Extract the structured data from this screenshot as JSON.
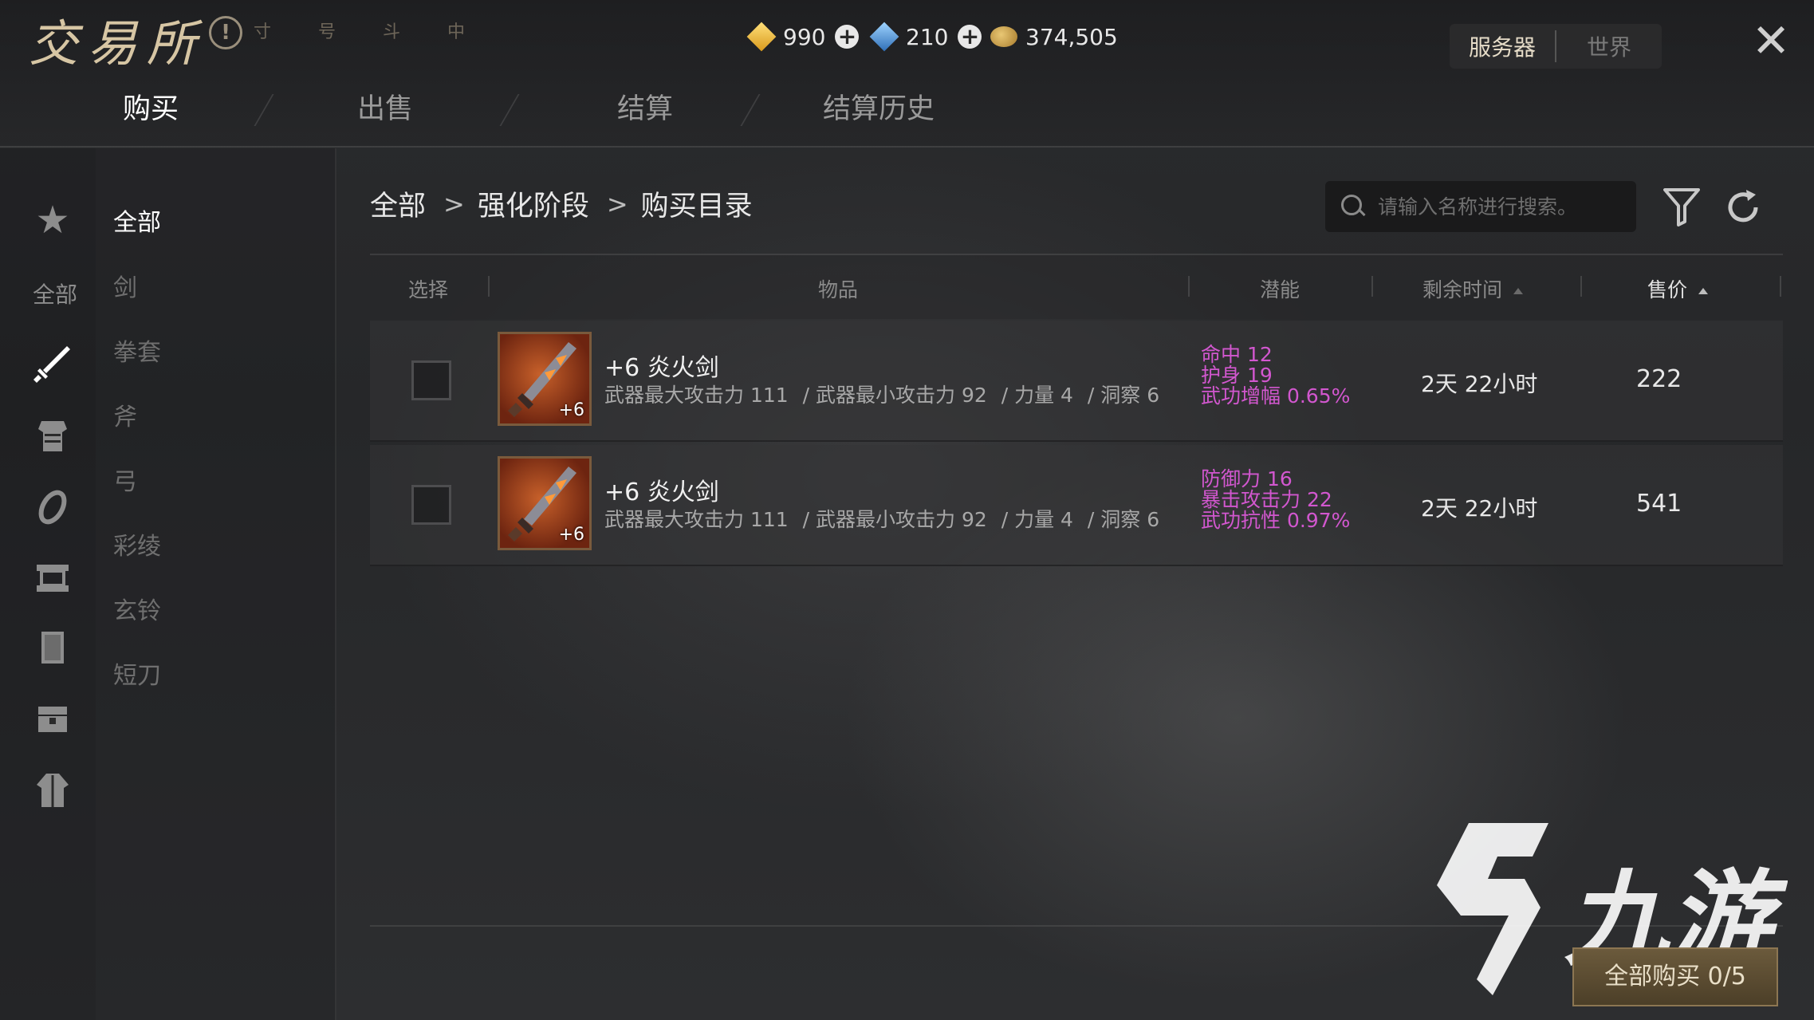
{
  "header": {
    "title": "交易所",
    "faint_marks": "寸 号 斗 中"
  },
  "currencies": [
    {
      "name": "gold-gem",
      "value": "990",
      "color": "#f0c23a"
    },
    {
      "name": "blue-gem",
      "value": "210",
      "color": "#4a9fe0"
    },
    {
      "name": "coin",
      "value": "374,505",
      "color": "#d9a94a"
    }
  ],
  "server_tabs": {
    "server": "服务器",
    "world": "世界"
  },
  "main_tabs": [
    "购买",
    "出售",
    "结算",
    "结算历史"
  ],
  "sidebar": {
    "all_label": "全部",
    "categories": [
      "全部",
      "剑",
      "拳套",
      "斧",
      "弓",
      "彩绫",
      "玄铃",
      "短刀"
    ]
  },
  "breadcrumb": [
    "全部",
    "强化阶段",
    "购买目录"
  ],
  "search": {
    "placeholder": "请输入名称进行搜索。"
  },
  "table": {
    "headers": {
      "select": "选择",
      "item": "物品",
      "potential": "潜能",
      "remaining": "剩余时间",
      "price": "售价"
    },
    "rows": [
      {
        "name": "+6 炎火剑",
        "badge": "+6",
        "stats": [
          "武器最大攻击力 111",
          "/ 武器最小攻击力 92",
          "/ 力量 4",
          "/ 洞察 6"
        ],
        "potential": [
          "命中 12",
          "护身 19",
          "武功增幅 0.65%"
        ],
        "remaining": "2天 22小时",
        "price": "222"
      },
      {
        "name": "+6 炎火剑",
        "badge": "+6",
        "stats": [
          "武器最大攻击力 111",
          "/ 武器最小攻击力 92",
          "/ 力量 4",
          "/ 洞察 6"
        ],
        "potential": [
          "防御力 16",
          "暴击攻击力 22",
          "武功抗性 0.97%"
        ],
        "remaining": "2天 22小时",
        "price": "541"
      }
    ]
  },
  "buy_all": "全部购买 0/5",
  "watermark": "九游",
  "colors": {
    "potential": "#d257cf",
    "accent": "#d7c6a4"
  }
}
